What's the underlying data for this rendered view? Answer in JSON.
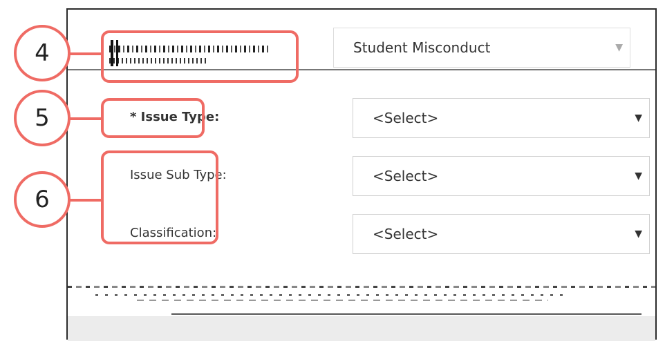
{
  "form": {
    "department": {
      "value": "Student Misconduct"
    },
    "issue_type": {
      "label": "* Issue Type:",
      "value": "<Select>"
    },
    "issue_sub_type": {
      "label": "Issue Sub Type:",
      "value": "<Select>"
    },
    "classification": {
      "label": "Classification:",
      "value": "<Select>"
    }
  },
  "callouts": [
    {
      "number": "4"
    },
    {
      "number": "5"
    },
    {
      "number": "6"
    }
  ],
  "colors": {
    "callout_accent": "#ef6b64"
  },
  "icons": {
    "dropdown": "chevron-down-icon"
  }
}
